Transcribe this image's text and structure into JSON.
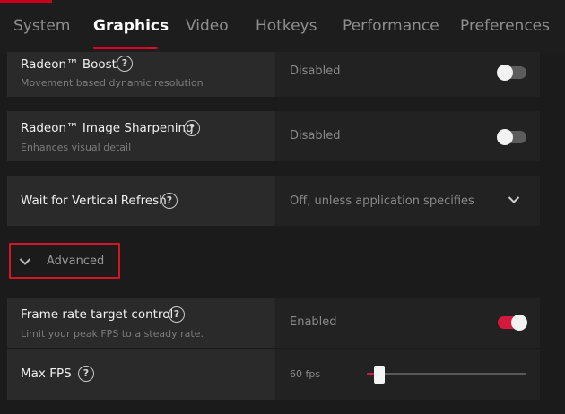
{
  "tabs": [
    {
      "label": "System"
    },
    {
      "label": "Graphics",
      "active": true
    },
    {
      "label": "Video"
    },
    {
      "label": "Hotkeys"
    },
    {
      "label": "Performance"
    },
    {
      "label": "Preferences"
    }
  ],
  "settings": {
    "boost": {
      "title": "Radeon™ Boost",
      "subtitle": "Movement based dynamic resolution",
      "value": "Disabled",
      "enabled": false
    },
    "sharpening": {
      "title": "Radeon™ Image Sharpening",
      "subtitle": "Enhances visual detail",
      "value": "Disabled",
      "enabled": false
    },
    "vsync": {
      "title": "Wait for Vertical Refresh",
      "value": "Off, unless application specifies"
    }
  },
  "advanced": {
    "label": "Advanced"
  },
  "frame_rate": {
    "title": "Frame rate target control",
    "subtitle": "Limit your peak FPS to a steady rate.",
    "value": "Enabled",
    "enabled": true
  },
  "max_fps": {
    "title": "Max FPS",
    "value": "60 fps",
    "slider_fraction": 0.08
  },
  "icons": {
    "help": "help-circle-icon",
    "chevron_down": "chevron-down-icon"
  },
  "colors": {
    "accent": "#d31a3c",
    "highlight_box": "#d21623",
    "background": "#1b1b1b"
  }
}
